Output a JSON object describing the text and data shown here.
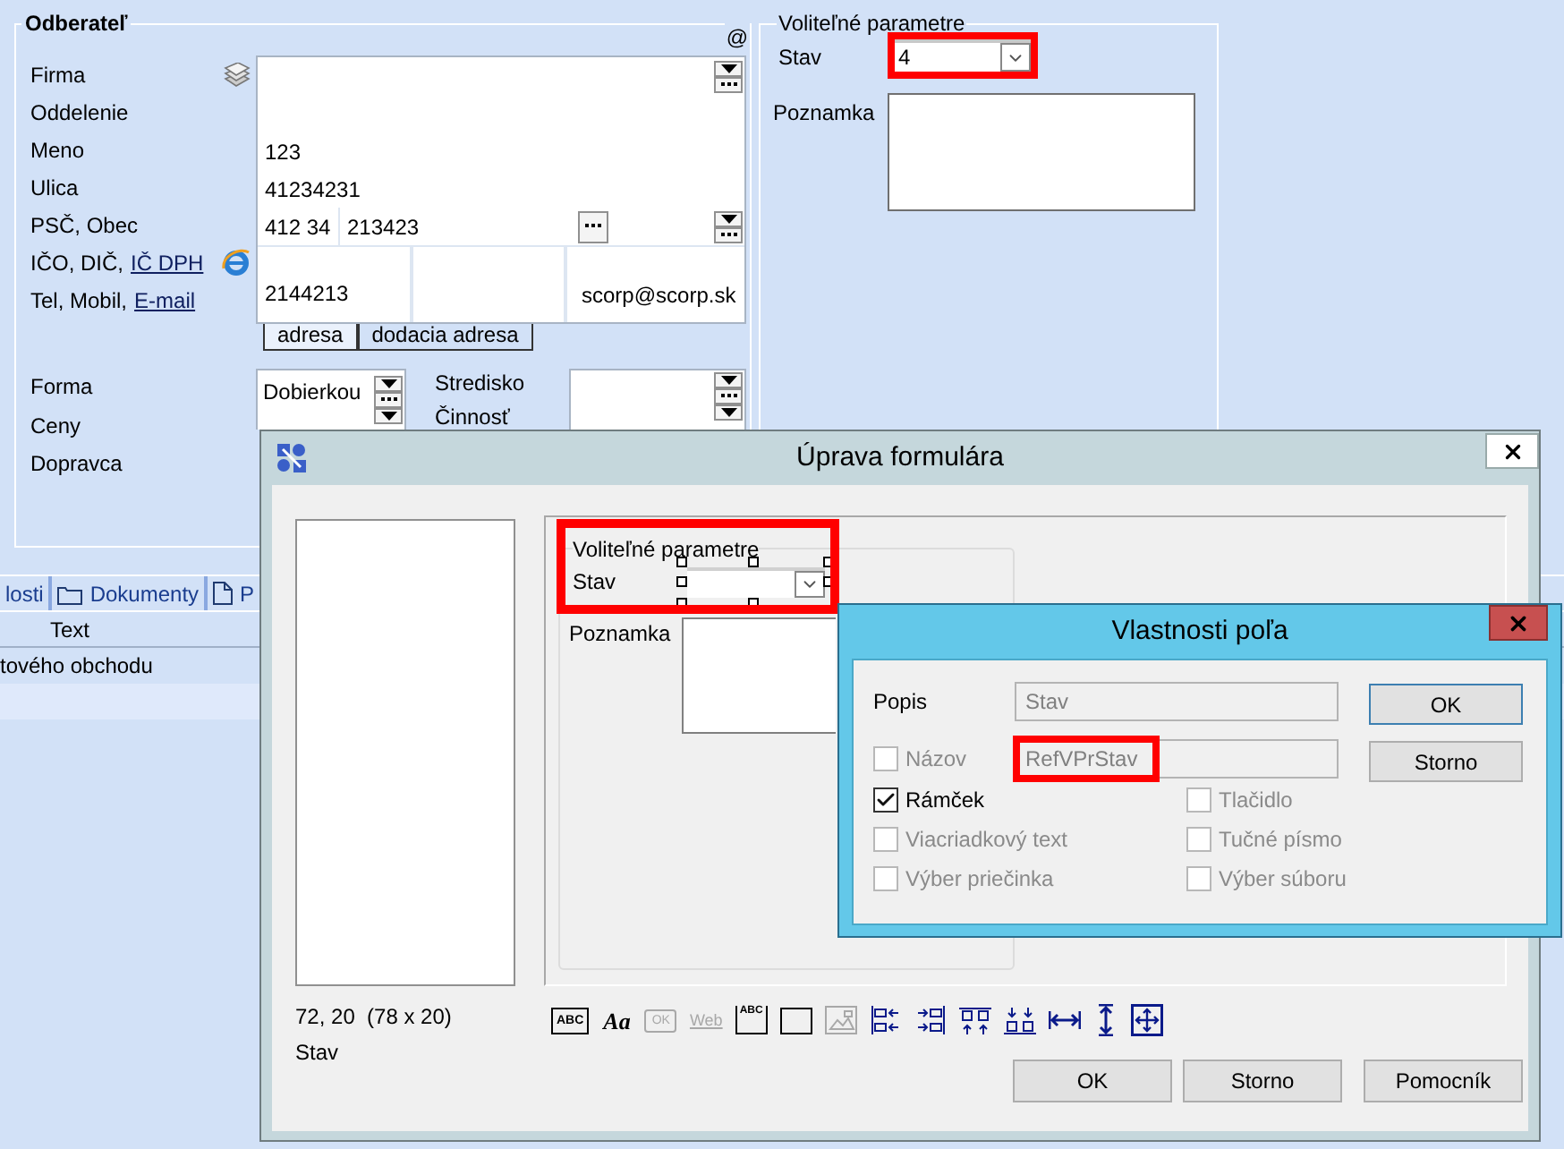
{
  "customer": {
    "title": "Odberateľ",
    "corner_mark": "@",
    "labels": [
      {
        "text": "Firma"
      },
      {
        "text": "Oddelenie"
      },
      {
        "text": "Meno"
      },
      {
        "text": "Ulica"
      },
      {
        "text": "PSČ, Obec"
      },
      {
        "text": "IČO, DIČ,",
        "link": "IČ DPH"
      },
      {
        "text": "Tel, Mobil,",
        "link": "E-mail"
      }
    ],
    "name": "123",
    "street": "41234231",
    "zip": "412 34",
    "city": "213423",
    "phone": "2144213",
    "email": "scorp@scorp.sk",
    "address_tabs": [
      {
        "label": "adresa",
        "selected": true
      },
      {
        "label": "dodacia adresa",
        "selected": false
      }
    ]
  },
  "terms": {
    "labels": [
      "Forma",
      "Ceny",
      "Dopravca"
    ],
    "payment": "Dobierkou",
    "side_labels": [
      "Stredisko",
      "Činnosť"
    ]
  },
  "optional_parameters": {
    "title": "Voliteľné parametre",
    "status_label": "Stav",
    "status_value": "4",
    "status_annotated": true,
    "note_label": "Poznamka"
  },
  "lower_tabs": [
    {
      "label": "losti",
      "kind": "plain"
    },
    {
      "label": "Dokumenty",
      "kind": "folder"
    },
    {
      "label": "P",
      "kind": "page"
    }
  ],
  "grid": {
    "columns": [
      "Text"
    ],
    "rows": [
      "tového obchodu"
    ]
  },
  "form_editor": {
    "title": "Úprava formulára",
    "position": "72, 20  (78 x 20)",
    "field_name": "Stav",
    "preview": {
      "group_title": "Voliteľné parametre",
      "status_label": "Stav",
      "note_label": "Poznamka",
      "annotated": true
    },
    "tools": [
      {
        "kind": "textbox",
        "glyph": "ABC",
        "disabled": false
      },
      {
        "kind": "font",
        "glyph": "Aa",
        "disabled": false
      },
      {
        "kind": "button",
        "glyph": "OK",
        "disabled": true
      },
      {
        "kind": "link",
        "glyph": "Web",
        "disabled": true
      },
      {
        "kind": "group",
        "glyph": "ABC",
        "disabled": false
      },
      {
        "kind": "frame",
        "disabled": false
      },
      {
        "kind": "image",
        "disabled": true
      },
      {
        "kind": "align-left",
        "disabled": false
      },
      {
        "kind": "align-right",
        "disabled": false
      },
      {
        "kind": "align-top",
        "disabled": false
      },
      {
        "kind": "align-bottom",
        "disabled": false
      },
      {
        "kind": "same-width",
        "disabled": false
      },
      {
        "kind": "same-height",
        "disabled": false
      },
      {
        "kind": "same-size",
        "disabled": false
      }
    ],
    "buttons": [
      "OK",
      "Storno",
      "Pomocník"
    ]
  },
  "field_properties": {
    "title": "Vlastnosti poľa",
    "caption_label": "Popis",
    "caption_value": "Stav",
    "name_option": {
      "label": "Názov",
      "checked": false,
      "disabled": true
    },
    "name_value": "RefVPrStav",
    "name_annotated": true,
    "options": [
      {
        "label": "Rámček",
        "checked": true,
        "disabled": false
      },
      {
        "label": "Tlačidlo",
        "checked": false,
        "disabled": true
      },
      {
        "label": "Viacriadkový text",
        "checked": false,
        "disabled": true
      },
      {
        "label": "Tučné písmo",
        "checked": false,
        "disabled": true
      },
      {
        "label": "Výber priečinka",
        "checked": false,
        "disabled": true
      },
      {
        "label": "Výber súboru",
        "checked": false,
        "disabled": true
      }
    ],
    "buttons": [
      "OK",
      "Storno"
    ]
  }
}
